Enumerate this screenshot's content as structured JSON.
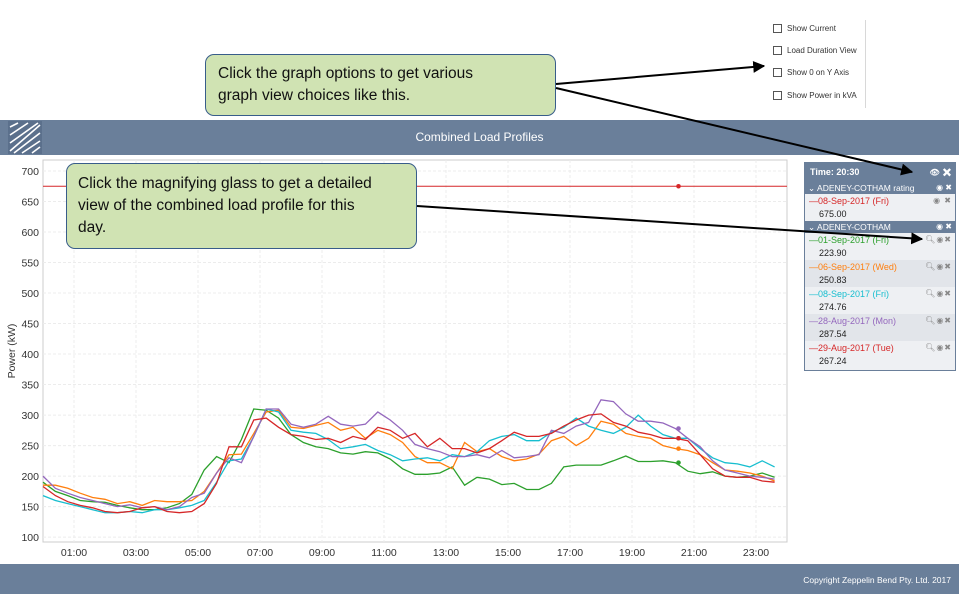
{
  "graph_options": [
    "Show Current",
    "Load Duration View",
    "Show 0 on Y Axis",
    "Show Power in kVA"
  ],
  "header": {
    "title": "Combined Load Profiles"
  },
  "footer": {
    "copyright": "Copyright Zeppelin Bend Pty. Ltd. 2017"
  },
  "legend": {
    "time_label": "Time: 20:30",
    "groups": [
      {
        "name": "ADENEY-COTHAM rating",
        "items": [
          {
            "label": "—08-Sep-2017 (Fri)",
            "value": "675.00",
            "color": "#d62728"
          }
        ]
      },
      {
        "name": "ADENEY-COTHAM",
        "items": [
          {
            "label": "—01-Sep-2017 (Fri)",
            "value": "223.90",
            "color": "#2ca02c"
          },
          {
            "label": "—06-Sep-2017 (Wed)",
            "value": "250.83",
            "color": "#ff7f0e"
          },
          {
            "label": "—08-Sep-2017 (Fri)",
            "value": "274.76",
            "color": "#17becf"
          },
          {
            "label": "—28-Aug-2017 (Mon)",
            "value": "287.54",
            "color": "#9467bd"
          },
          {
            "label": "—29-Aug-2017 (Tue)",
            "value": "267.24",
            "color": "#d62728"
          }
        ]
      }
    ]
  },
  "callouts": {
    "options": [
      "Click the graph options to get various",
      "graph view choices like this."
    ],
    "magnify": [
      "Click the magnifying glass to get a detailed",
      "view of the combined load profile for this",
      "day."
    ]
  },
  "chart_data": {
    "type": "line",
    "ylabel": "Power (kW)",
    "xlabel": "",
    "x_ticks": [
      "01:00",
      "03:00",
      "05:00",
      "07:00",
      "09:00",
      "11:00",
      "13:00",
      "15:00",
      "17:00",
      "19:00",
      "21:00",
      "23:00"
    ],
    "y_ticks": [
      100,
      150,
      200,
      250,
      300,
      350,
      400,
      450,
      500,
      550,
      600,
      650,
      700
    ],
    "ylim": [
      92,
      718
    ],
    "xlim": [
      0.0,
      24.0
    ],
    "grid": true,
    "cursor_time": 20.5,
    "rating": {
      "name": "ADENEY-COTHAM rating",
      "value": 675,
      "color": "#d62728"
    },
    "series": [
      {
        "name": "01-Sep-2017 (Fri)",
        "color": "#2ca02c",
        "values": [
          190,
          175,
          168,
          160,
          158,
          157,
          152,
          148,
          145,
          145,
          148,
          155,
          170,
          210,
          232,
          222,
          260,
          310,
          308,
          295,
          268,
          255,
          248,
          245,
          238,
          236,
          240,
          238,
          228,
          212,
          203,
          203,
          205,
          215,
          185,
          198,
          195,
          186,
          188,
          178,
          178,
          188,
          215,
          218,
          218,
          218,
          225,
          233,
          224,
          224,
          225,
          222,
          208,
          204,
          207,
          200,
          198,
          200,
          205,
          198
        ]
      },
      {
        "name": "06-Sep-2017 (Wed)",
        "color": "#ff7f0e",
        "values": [
          185,
          185,
          180,
          172,
          165,
          162,
          155,
          158,
          152,
          160,
          158,
          158,
          160,
          175,
          205,
          235,
          236,
          270,
          305,
          308,
          280,
          278,
          283,
          288,
          275,
          280,
          262,
          275,
          268,
          255,
          232,
          222,
          222,
          212,
          255,
          240,
          245,
          232,
          225,
          228,
          236,
          258,
          265,
          250,
          262,
          290,
          285,
          270,
          265,
          262,
          250,
          245,
          242,
          235,
          222,
          210,
          208,
          205,
          200,
          192
        ]
      },
      {
        "name": "08-Sep-2017 (Fri)",
        "color": "#17becf",
        "values": [
          168,
          160,
          155,
          150,
          145,
          140,
          140,
          142,
          140,
          145,
          145,
          148,
          152,
          160,
          190,
          225,
          228,
          265,
          310,
          305,
          275,
          272,
          270,
          260,
          245,
          248,
          252,
          242,
          235,
          225,
          228,
          230,
          225,
          235,
          232,
          240,
          258,
          265,
          268,
          258,
          258,
          272,
          280,
          295,
          282,
          275,
          270,
          280,
          300,
          282,
          268,
          262,
          262,
          245,
          230,
          222,
          220,
          215,
          225,
          215
        ]
      },
      {
        "name": "28-Aug-2017 (Mon)",
        "color": "#9467bd",
        "values": [
          200,
          180,
          172,
          165,
          160,
          155,
          150,
          153,
          148,
          150,
          145,
          150,
          165,
          172,
          205,
          230,
          222,
          265,
          310,
          310,
          285,
          280,
          285,
          298,
          285,
          282,
          285,
          305,
          292,
          275,
          252,
          245,
          240,
          232,
          232,
          235,
          230,
          242,
          230,
          232,
          235,
          275,
          270,
          282,
          288,
          325,
          322,
          302,
          290,
          290,
          287,
          278,
          262,
          248,
          225,
          210,
          205,
          200,
          198,
          195
        ]
      },
      {
        "name": "29-Aug-2017 (Tue)",
        "color": "#d62728",
        "values": [
          183,
          168,
          158,
          152,
          148,
          142,
          140,
          142,
          148,
          150,
          142,
          140,
          142,
          155,
          188,
          248,
          248,
          292,
          295,
          280,
          268,
          265,
          260,
          262,
          255,
          265,
          260,
          280,
          275,
          262,
          270,
          248,
          262,
          245,
          245,
          238,
          245,
          258,
          272,
          265,
          265,
          270,
          282,
          292,
          300,
          302,
          288,
          282,
          272,
          268,
          262,
          262,
          258,
          235,
          212,
          200,
          198,
          198,
          192,
          190
        ]
      }
    ]
  }
}
